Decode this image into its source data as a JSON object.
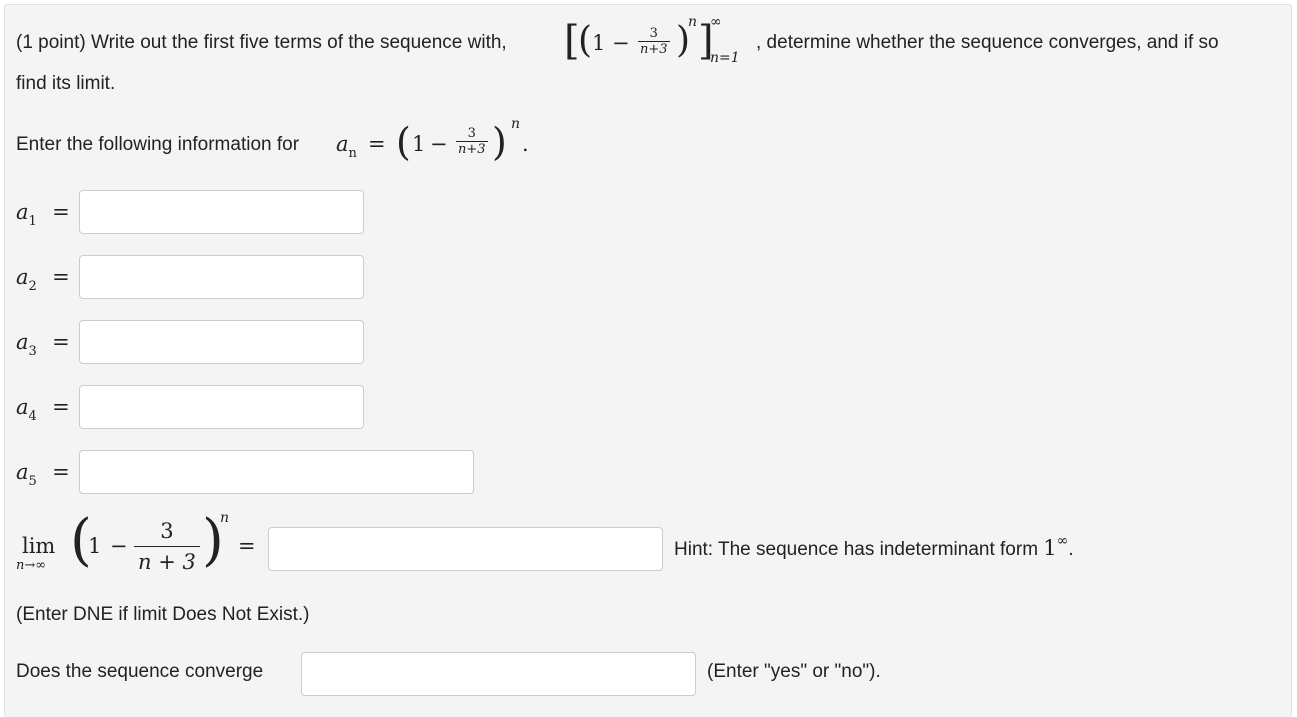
{
  "problem": {
    "intro_prefix": "(1 point) Write out the first five terms of the sequence with,",
    "intro_suffix": ", determine whether the sequence converges, and if so",
    "intro_line2": "find its limit.",
    "seq_one": "1",
    "seq_minus": "−",
    "seq_num": "3",
    "seq_den": "n+3",
    "seq_exp": "n",
    "seq_upper": "∞",
    "seq_lower": "n=1"
  },
  "instruction": {
    "text": "Enter the following information for",
    "var": "a",
    "var_sub": "n",
    "eq": "=",
    "one": "1",
    "minus": "−",
    "num": "3",
    "den": "n+3",
    "exp": "n",
    "period": "."
  },
  "terms": [
    {
      "var": "a",
      "sub": "1",
      "eq": "=",
      "value": ""
    },
    {
      "var": "a",
      "sub": "2",
      "eq": "=",
      "value": ""
    },
    {
      "var": "a",
      "sub": "3",
      "eq": "=",
      "value": ""
    },
    {
      "var": "a",
      "sub": "4",
      "eq": "=",
      "value": ""
    },
    {
      "var": "a",
      "sub": "5",
      "eq": "=",
      "value": ""
    }
  ],
  "limit": {
    "lim": "lim",
    "under": "n→∞",
    "one": "1",
    "minus": "−",
    "num": "3",
    "den": "n + 3",
    "exp": "n",
    "eq": "=",
    "value": "",
    "hint_text": "Hint: The sequence has indeterminant form",
    "hint_base": "1",
    "hint_exp": "∞",
    "hint_period": "."
  },
  "dne_note": "(Enter DNE if limit Does Not Exist.)",
  "converge": {
    "label": "Does the sequence converge",
    "value": "",
    "note": "(Enter \"yes\" or \"no\")."
  }
}
